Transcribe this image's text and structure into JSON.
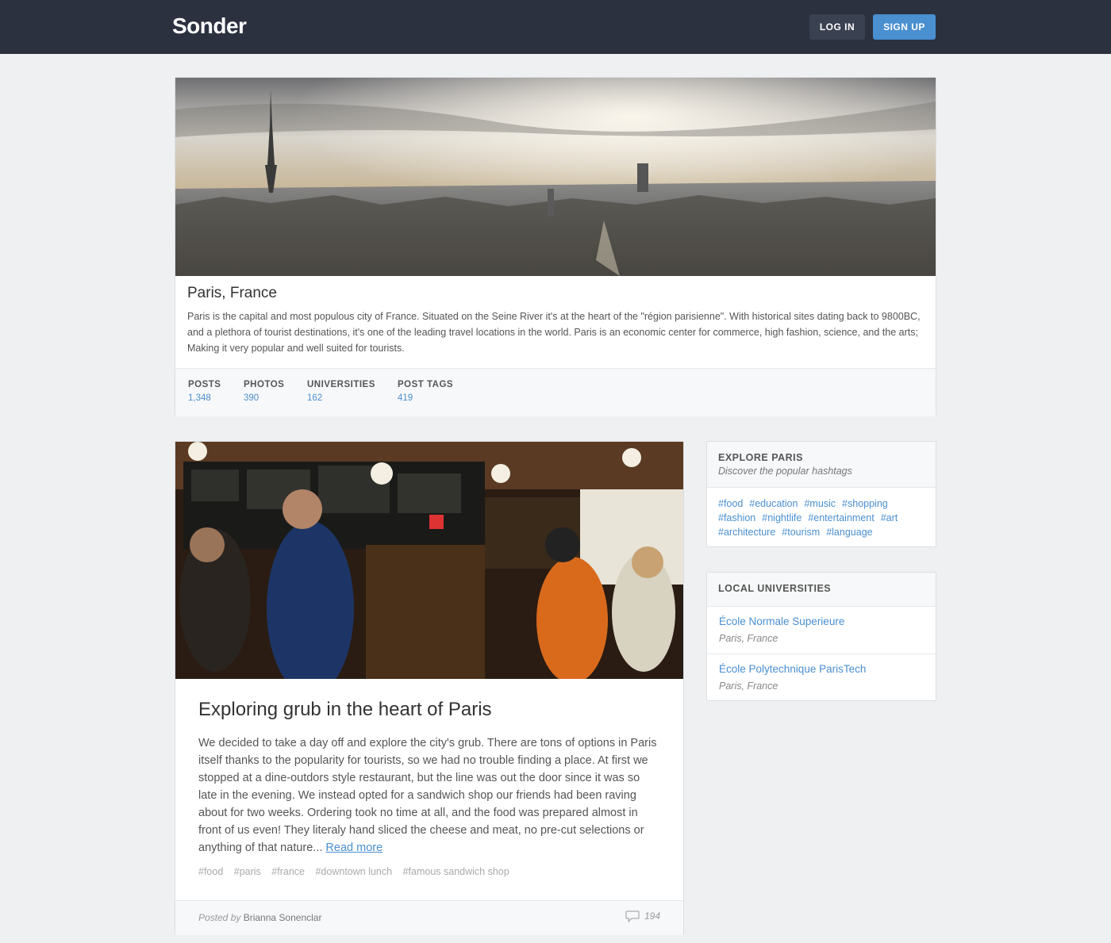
{
  "header": {
    "brand": "Sonder",
    "login_label": "LOG IN",
    "signup_label": "SIGN UP"
  },
  "city": {
    "title": "Paris, France",
    "description": "Paris is the capital and most populous city of France. Situated on the Seine River it's at the heart of the \"région parisienne\". With historical sites dating back to 9800BC, and a plethora of tourist destinations, it's one of the leading travel locations in the world. Paris is an economic center for commerce, high fashion, science, and the arts; Making it very popular and well suited for tourists.",
    "stats": [
      {
        "label": "POSTS",
        "value": "1,348"
      },
      {
        "label": "PHOTOS",
        "value": "390"
      },
      {
        "label": "UNIVERSITIES",
        "value": "162"
      },
      {
        "label": "POST TAGS",
        "value": "419"
      }
    ]
  },
  "post": {
    "title": "Exploring grub in the heart of Paris",
    "body": "We decided to take a day off and explore the city's grub. There are tons of options in Paris itself thanks to the popularity for tourists, so we had no trouble finding a place. At first we stopped at a dine-outdors style restaurant, but the line was out the door since it was so late in the evening. We instead opted for a sandwich shop our friends had been raving about for two weeks. Ordering took no time at all, and the food was prepared almost in front of us even! They literaly hand sliced the cheese and meat, no pre-cut selections or anything of that nature...",
    "read_more": "Read more",
    "tags": [
      "#food",
      "#paris",
      "#france",
      "#downtown lunch",
      "#famous sandwich shop"
    ],
    "posted_by_label": "Posted by",
    "author": "Brianna Sonenclar",
    "comment_count": "194"
  },
  "explore": {
    "title": "EXPLORE PARIS",
    "subtitle": "Discover the popular hashtags",
    "tags": [
      "#food",
      "#education",
      "#music",
      "#shopping",
      "#fashion",
      "#nightlife",
      "#entertainment",
      "#art",
      "#architecture",
      "#tourism",
      "#language"
    ]
  },
  "universities": {
    "title": "LOCAL UNIVERSITIES",
    "items": [
      {
        "name": "École Normale Superieure",
        "location": "Paris, France"
      },
      {
        "name": "École Polytechnique ParisTech",
        "location": "Paris, France"
      }
    ]
  }
}
